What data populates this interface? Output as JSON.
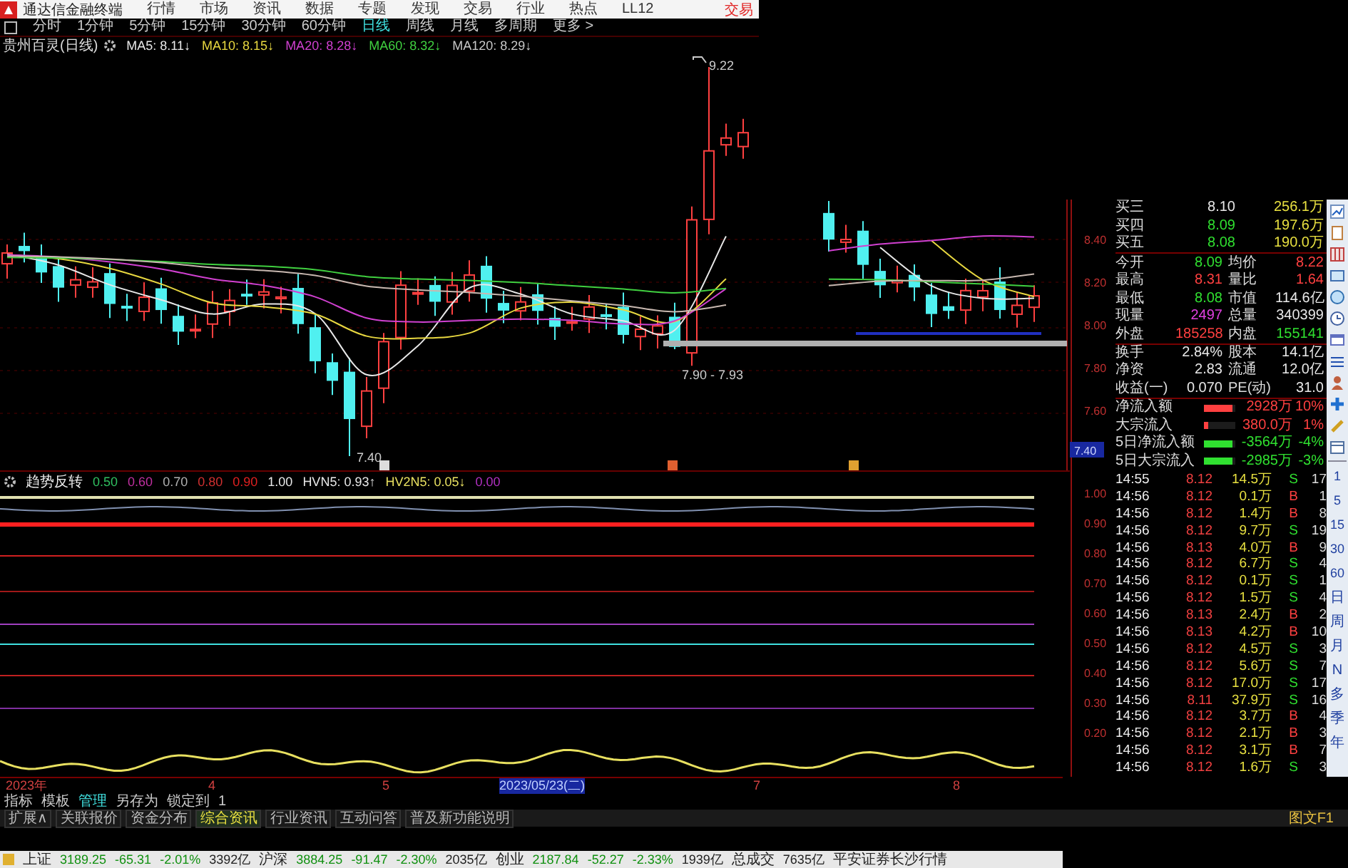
{
  "menu_bar": {
    "title": "通达信金融终端",
    "items": [
      "行情",
      "市场",
      "资讯",
      "数据",
      "专题",
      "发现",
      "交易",
      "行业",
      "热点",
      "LL12"
    ],
    "trade_button": "交易"
  },
  "period_bar": {
    "items": [
      {
        "label": "分时",
        "selected": false
      },
      {
        "label": "1分钟",
        "selected": false
      },
      {
        "label": "5分钟",
        "selected": false
      },
      {
        "label": "15分钟",
        "selected": false
      },
      {
        "label": "30分钟",
        "selected": false
      },
      {
        "label": "60分钟",
        "selected": false
      },
      {
        "label": "日线",
        "selected": true
      },
      {
        "label": "周线",
        "selected": false
      },
      {
        "label": "月线",
        "selected": false
      },
      {
        "label": "多周期",
        "selected": false
      },
      {
        "label": "更多 >",
        "selected": false
      }
    ]
  },
  "ma_legend": {
    "stock": "贵州百灵(日线)",
    "items": [
      {
        "label": "MA5: 8.11↓",
        "color": "#e8e8e8"
      },
      {
        "label": "MA10: 8.15↓",
        "color": "#e8d840"
      },
      {
        "label": "MA20: 8.28↓",
        "color": "#d040d0"
      },
      {
        "label": "MA60: 8.32↓",
        "color": "#40d040"
      },
      {
        "label": "MA120: 8.29↓",
        "color": "#c8c8c8"
      }
    ]
  },
  "main_chart": {
    "price_axis": [
      "8.40",
      "8.20",
      "8.00",
      "7.80",
      "7.60"
    ],
    "current_price": "7.40",
    "high_label": "9.22",
    "range_label": "7.90 - 7.93",
    "low_label": "7.40"
  },
  "quote_panel": {
    "order_book": [
      {
        "label": "买三",
        "price": "8.10",
        "color": "#e8e8e8",
        "volume": "256.1万"
      },
      {
        "label": "买四",
        "price": "8.09",
        "color": "#30e030",
        "volume": "197.6万"
      },
      {
        "label": "买五",
        "price": "8.08",
        "color": "#30e030",
        "volume": "190.0万"
      }
    ],
    "stats": [
      {
        "cells": [
          {
            "label": "今开",
            "value": "8.09",
            "color": "#30e030"
          },
          {
            "label": "均价",
            "value": "8.22",
            "color": "#ff4040"
          }
        ]
      },
      {
        "cells": [
          {
            "label": "最高",
            "value": "8.31",
            "color": "#ff4040"
          },
          {
            "label": "量比",
            "value": "1.64",
            "color": "#ff4040"
          }
        ]
      },
      {
        "cells": [
          {
            "label": "最低",
            "value": "8.08",
            "color": "#30e030"
          },
          {
            "label": "市值",
            "value": "114.6亿",
            "color": "#e8e8e8"
          }
        ]
      },
      {
        "cells": [
          {
            "label": "现量",
            "value": "2497",
            "color": "#e040e0"
          },
          {
            "label": "总量",
            "value": "340399",
            "color": "#e8e8e8"
          }
        ]
      },
      {
        "cells": [
          {
            "label": "外盘",
            "value": "185258",
            "color": "#ff4040"
          },
          {
            "label": "内盘",
            "value": "155141",
            "color": "#30e030"
          }
        ]
      },
      {
        "cells": [
          {
            "label": "换手",
            "value": "2.84%",
            "color": "#e8e8e8"
          },
          {
            "label": "股本",
            "value": "14.1亿",
            "color": "#e8e8e8"
          }
        ]
      },
      {
        "cells": [
          {
            "label": "净资",
            "value": "2.83",
            "color": "#e8e8e8"
          },
          {
            "label": "流通",
            "value": "12.0亿",
            "color": "#e8e8e8"
          }
        ]
      },
      {
        "cells": [
          {
            "label": "收益(一)",
            "value": "0.070",
            "color": "#e8e8e8"
          },
          {
            "label": "PE(动)",
            "value": "31.0",
            "color": "#e8e8e8"
          }
        ]
      }
    ],
    "flows": [
      {
        "label": "净流入额",
        "color": "#ff4040",
        "level": 0.9,
        "amount": "2928万",
        "percent": "10%"
      },
      {
        "label": "大宗流入",
        "color": "#ff4040",
        "level": 0.12,
        "amount": "380.0万",
        "percent": "1%"
      },
      {
        "label": "5日净流入额",
        "color": "#30e030",
        "level": 0.9,
        "amount": "-3564万",
        "percent": "-4%"
      },
      {
        "label": "5日大宗流入",
        "color": "#30e030",
        "level": 0.9,
        "amount": "-2985万",
        "percent": "-3%"
      }
    ]
  },
  "indicator": {
    "title": "趋势反转",
    "legend": [
      {
        "label": "0.50",
        "color": "#30c060"
      },
      {
        "label": "0.60",
        "color": "#c030a0"
      },
      {
        "label": "0.70",
        "color": "#b0b0b0"
      },
      {
        "label": "0.80",
        "color": "#d03030"
      },
      {
        "label": "0.90",
        "color": "#e02020"
      },
      {
        "label": "1.00",
        "color": "#e8e8e8"
      },
      {
        "label": "HVN5: 0.93↑",
        "color": "#e8e8e8"
      },
      {
        "label": "HV2N5: 0.05↓",
        "color": "#e8e060"
      },
      {
        "label": "0.00",
        "color": "#b030c0"
      }
    ],
    "axis": [
      "1.00",
      "0.90",
      "0.80",
      "0.70",
      "0.60",
      "0.50",
      "0.40",
      "0.30",
      "0.20"
    ]
  },
  "ticks": [
    {
      "time": "14:55",
      "price": "8.12",
      "volume": "14.5万",
      "side": "S",
      "count": "17"
    },
    {
      "time": "14:56",
      "price": "8.12",
      "volume": "0.1万",
      "side": "B",
      "count": "1"
    },
    {
      "time": "14:56",
      "price": "8.12",
      "volume": "1.4万",
      "side": "B",
      "count": "8"
    },
    {
      "time": "14:56",
      "price": "8.12",
      "volume": "9.7万",
      "side": "S",
      "count": "19"
    },
    {
      "time": "14:56",
      "price": "8.13",
      "volume": "4.0万",
      "side": "B",
      "count": "9"
    },
    {
      "time": "14:56",
      "price": "8.12",
      "volume": "6.7万",
      "side": "S",
      "count": "4"
    },
    {
      "time": "14:56",
      "price": "8.12",
      "volume": "0.1万",
      "side": "S",
      "count": "1"
    },
    {
      "time": "14:56",
      "price": "8.12",
      "volume": "1.5万",
      "side": "S",
      "count": "4"
    },
    {
      "time": "14:56",
      "price": "8.13",
      "volume": "2.4万",
      "side": "B",
      "count": "2"
    },
    {
      "time": "14:56",
      "price": "8.13",
      "volume": "4.2万",
      "side": "B",
      "count": "10"
    },
    {
      "time": "14:56",
      "price": "8.12",
      "volume": "4.5万",
      "side": "S",
      "count": "3"
    },
    {
      "time": "14:56",
      "price": "8.12",
      "volume": "5.6万",
      "side": "S",
      "count": "7"
    },
    {
      "time": "14:56",
      "price": "8.12",
      "volume": "17.0万",
      "side": "S",
      "count": "17"
    },
    {
      "time": "14:56",
      "price": "8.11",
      "volume": "37.9万",
      "side": "S",
      "count": "16"
    },
    {
      "time": "14:56",
      "price": "8.12",
      "volume": "3.7万",
      "side": "B",
      "count": "4"
    },
    {
      "time": "14:56",
      "price": "8.12",
      "volume": "2.1万",
      "side": "B",
      "count": "3"
    },
    {
      "time": "14:56",
      "price": "8.12",
      "volume": "3.1万",
      "side": "B",
      "count": "7"
    },
    {
      "time": "14:56",
      "price": "8.12",
      "volume": "1.6万",
      "side": "S",
      "count": "3"
    }
  ],
  "side_toolbar": {
    "periods": [
      "1",
      "5",
      "15",
      "30",
      "60",
      "日",
      "周",
      "月",
      "N",
      "多",
      "季",
      "年"
    ]
  },
  "date_axis": [
    {
      "label": "2023年",
      "selected": false
    },
    {
      "label": "4",
      "selected": false
    },
    {
      "label": "5",
      "selected": false
    },
    {
      "label": "2023/05/23(二)",
      "selected": true
    },
    {
      "label": "7",
      "selected": false
    },
    {
      "label": "8",
      "selected": false
    }
  ],
  "indicator_tabs": [
    {
      "label": "指标",
      "selected": false
    },
    {
      "label": "模板",
      "selected": false
    },
    {
      "label": "管理",
      "selected": true
    },
    {
      "label": "另存为",
      "selected": false
    },
    {
      "label": "锁定到",
      "selected": false
    },
    {
      "label": "1",
      "selected": false
    }
  ],
  "extension_tabs": [
    {
      "label": "扩展∧",
      "selected": false
    },
    {
      "label": "关联报价",
      "selected": false
    },
    {
      "label": "资金分布",
      "selected": false
    },
    {
      "label": "综合资讯",
      "selected": true
    },
    {
      "label": "行业资讯",
      "selected": false
    },
    {
      "label": "互动问答",
      "selected": false
    },
    {
      "label": "普及新功能说明",
      "selected": false
    }
  ],
  "right_link": "图文F1",
  "status_bar": {
    "indices": [
      {
        "name": "上证",
        "value": "3189.25",
        "change": "-65.31",
        "percent": "-2.01%",
        "turnover": "3392亿"
      },
      {
        "name": "沪深",
        "value": "3884.25",
        "change": "-91.47",
        "percent": "-2.30%",
        "turnover": "2035亿"
      },
      {
        "name": "创业",
        "value": "2187.84",
        "change": "-52.27",
        "percent": "-2.33%",
        "turnover": "1939亿"
      }
    ],
    "total_label": "总成交",
    "total_value": "7635亿",
    "broker": "平安证券长沙行情"
  }
}
